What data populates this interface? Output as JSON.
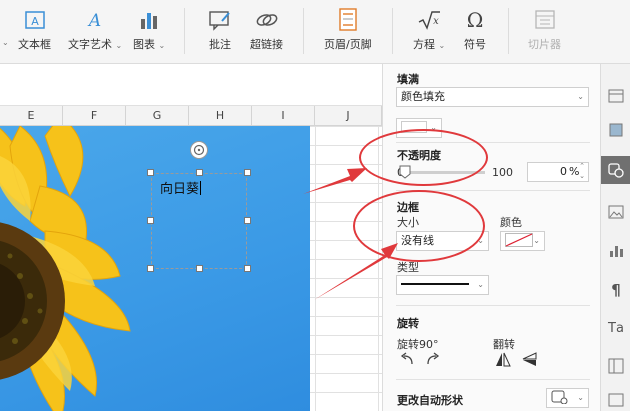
{
  "toolbar": {
    "textbox": "文本框",
    "wordart": "文字艺术",
    "chart": "图表",
    "comment": "批注",
    "hyperlink": "超链接",
    "header_footer": "页眉/页脚",
    "equation": "方程",
    "symbol": "符号",
    "slicer": "切片器"
  },
  "columns": [
    "E",
    "F",
    "G",
    "H",
    "I",
    "J"
  ],
  "textbox": {
    "text": "向日葵"
  },
  "panel": {
    "fill_title": "填满",
    "fill_type": "颜色填充",
    "opacity_title": "不透明度",
    "opacity_min": "0",
    "opacity_max": "100",
    "opacity_value": "0",
    "opacity_unit": "%",
    "opacity_level_percent": 0,
    "border_title": "边框",
    "size_label": "大小",
    "size_value": "没有线",
    "color_label": "颜色",
    "type_label": "类型",
    "rotate_title": "旋转",
    "rotate90_label": "旋转90°",
    "flip_label": "翻转",
    "autoshape_label": "更改自动形状"
  },
  "colors": {
    "annotation": "#e0393c",
    "sky": "#3b9ae6",
    "petal": "#f6c21a"
  }
}
